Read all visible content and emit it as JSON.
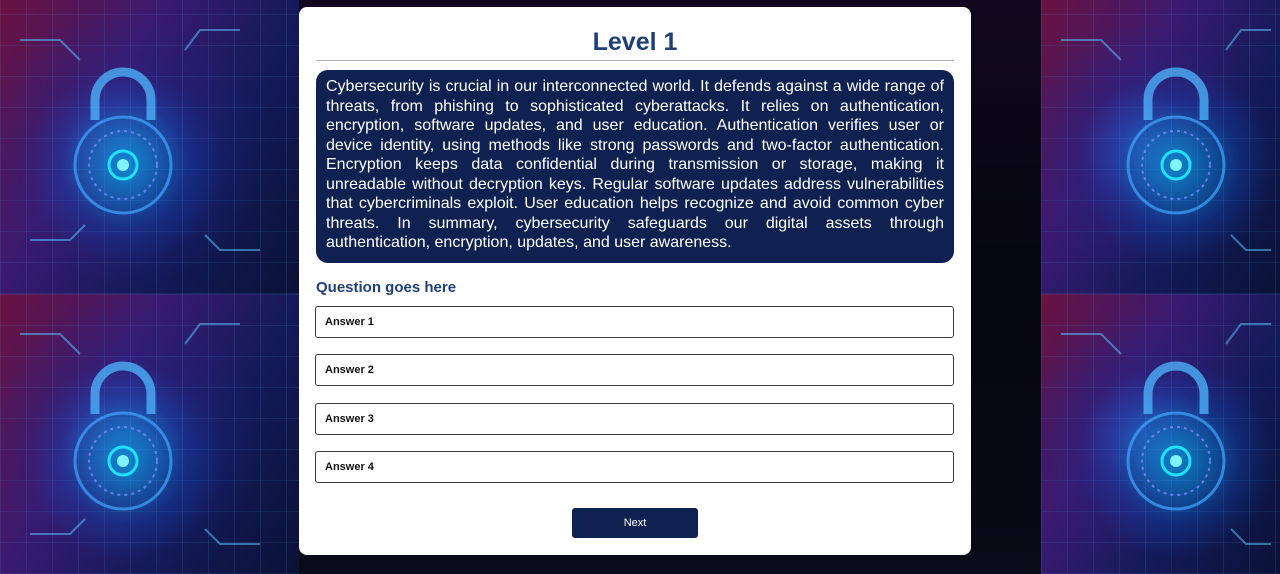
{
  "quiz": {
    "level_title": "Level 1",
    "passage": "Cybersecurity is crucial in our interconnected world. It defends against a wide range of threats, from phishing to sophisticated cyberattacks. It relies on authentication, encryption, software updates, and user education. Authentication verifies user or device identity, using methods like strong passwords and two-factor authentication. Encryption keeps data confidential during transmission or storage, making it unreadable without decryption keys. Regular software updates address vulnerabilities that cybercriminals exploit. User education helps recognize and avoid common cyber threats. In summary, cybersecurity safeguards our digital assets through authentication, encryption, updates, and user awareness.",
    "question": "Question goes here",
    "answers": [
      "Answer 1",
      "Answer 2",
      "Answer 3",
      "Answer 4"
    ],
    "next_label": "Next"
  },
  "background": {
    "image_icon": "padlock-circuit-icon"
  },
  "colors": {
    "accent_navy": "#0f2150",
    "title_blue": "#1f3f7a",
    "card_bg": "#ffffff"
  }
}
